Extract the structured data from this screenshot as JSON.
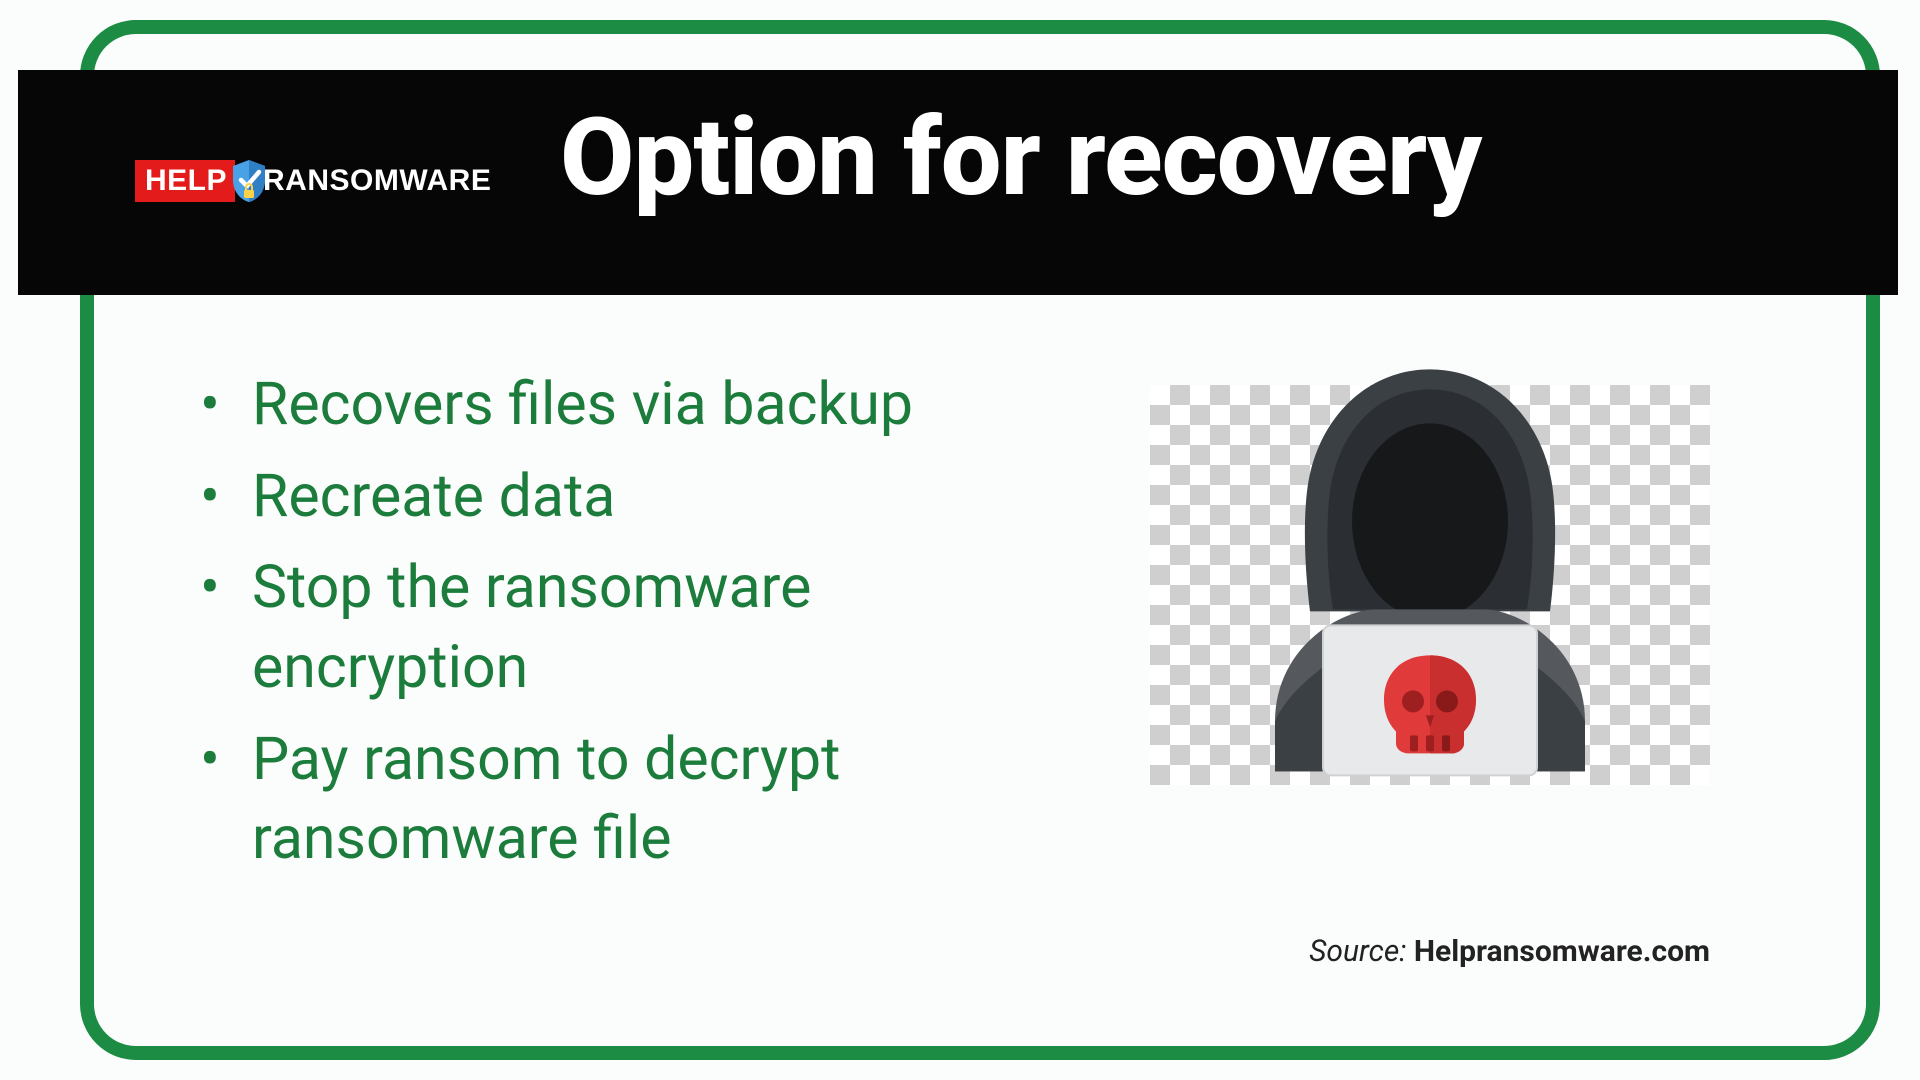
{
  "logo": {
    "help": "HELP",
    "ransom": "RANSOMWARE"
  },
  "title": "Option for recovery",
  "bullets": [
    "Recovers files via backup",
    "Recreate data",
    "Stop the ransomware encryption",
    "Pay ransom to decrypt ransomware file"
  ],
  "source": {
    "label": "Source: ",
    "name": "Helpransomware.com"
  },
  "colors": {
    "accent": "#1c8b44",
    "text_green": "#1c7c3c",
    "red": "#e31b1b",
    "skull": "#e03a3a"
  }
}
